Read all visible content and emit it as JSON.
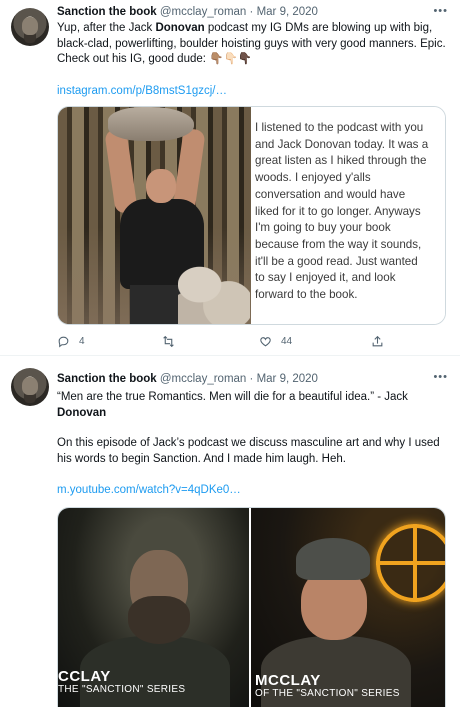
{
  "tweets": [
    {
      "author_name": "Sanction the book",
      "handle": "@mcclay_roman",
      "separator": "·",
      "date": "Mar 9, 2020",
      "more_icon": "more-horizontal-icon",
      "text_before": "Yup, after the Jack ",
      "text_bold": "Donovan",
      "text_after": " podcast my IG DMs are blowing up with big, black-clad, powerlifting, boulder hoisting guys with very good manners. Epic. Check out his IG, good dude: 👇🏽👇🏻👇🏿",
      "link": "instagram.com/p/B8mstS1gzcj/…",
      "media_text_lines": [
        "I listened to the podcast with you",
        "and Jack Donovan today. It was a",
        "great listen as I hiked through the",
        "woods. I enjoyed y'alls",
        "conversation and would have",
        "liked for it to go longer. Anyways",
        "I'm going to buy your book",
        "because from the way it sounds,",
        "it'll be a good read. Just wanted",
        "to say I enjoyed it, and look",
        "forward to the book."
      ],
      "actions": {
        "reply_count": "4",
        "retweet_count": "",
        "like_count": "44"
      }
    },
    {
      "author_name": "Sanction the book",
      "handle": "@mcclay_roman",
      "separator": "·",
      "date": "Mar 9, 2020",
      "more_icon": "more-horizontal-icon",
      "quote_line": "“Men are the true Romantics. Men will die for a beautiful idea.” - Jack",
      "quote_bold": "Donovan",
      "paragraph": "On this episode of Jack’s podcast we discuss masculine art and why I used his words to begin Sanction. And I made him laugh. Heh.",
      "link": "m.youtube.com/watch?v=4qDKe0…",
      "video_caption_left": {
        "big": "CCLAY",
        "small": "THE \"SANCTION\" SERIES"
      },
      "video_caption_right": {
        "big": "MCCLAY",
        "small": "OF THE \"SANCTION\" SERIES"
      }
    }
  ],
  "colors": {
    "link": "#1d9bf0",
    "secondary_text": "#536471",
    "primary_text": "#0f1419",
    "border": "#cfd9de",
    "neon_sign": "#f0a31f"
  }
}
